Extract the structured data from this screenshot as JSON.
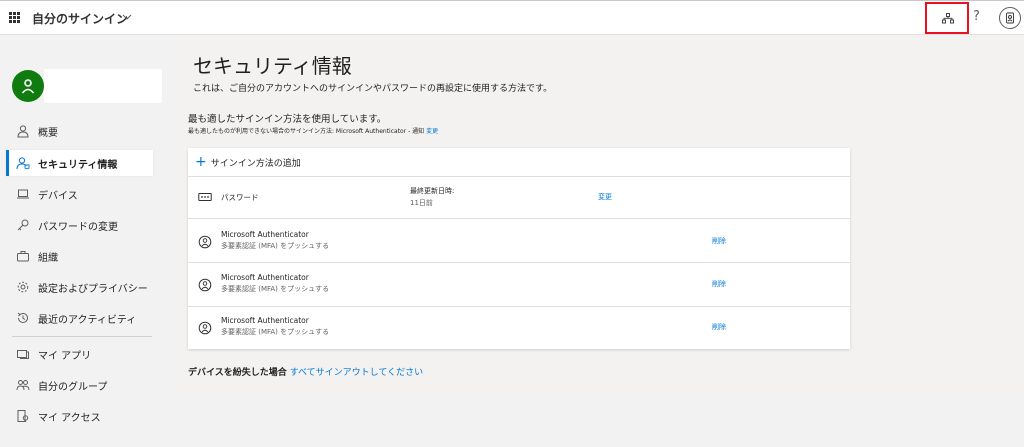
{
  "header": {
    "app_title": "自分のサインイン",
    "help_label": "?"
  },
  "sidebar": {
    "items": [
      {
        "label": "概要"
      },
      {
        "label": "セキュリティ情報"
      },
      {
        "label": "デバイス"
      },
      {
        "label": "パスワードの変更"
      },
      {
        "label": "組織"
      },
      {
        "label": "設定およびプライバシー"
      },
      {
        "label": "最近のアクティビティ"
      },
      {
        "label": "マイ アプリ"
      },
      {
        "label": "自分のグループ"
      },
      {
        "label": "マイ アクセス"
      }
    ]
  },
  "main": {
    "title": "セキュリティ情報",
    "description": "これは、ご自分のアカウントへのサインインやパスワードの再設定に使用する方法です。",
    "default_heading": "最も適したサインイン方法を使用しています。",
    "default_sub_text": "最も適したものが利用できない場合のサインイン方法: Microsoft Authenticator - 通知",
    "default_sub_link": "変更",
    "add_method_label": "サインイン方法の追加",
    "methods": [
      {
        "name": "パスワード",
        "mid_label": "最終更新日時:",
        "mid_value": "11日前",
        "action": "変更"
      },
      {
        "name": "Microsoft Authenticator",
        "sub": "多要素認証 (MFA) をプッシュする",
        "action": "削除"
      },
      {
        "name": "Microsoft Authenticator",
        "sub": "多要素認証 (MFA) をプッシュする",
        "action": "削除"
      },
      {
        "name": "Microsoft Authenticator",
        "sub": "多要素認証 (MFA) をプッシュする",
        "action": "削除"
      }
    ],
    "lost_device_bold": "デバイスを紛失した場合",
    "lost_device_link": "すべてサインアウトしてください"
  },
  "colors": {
    "accent": "#0078d4",
    "avatar_green": "#107c10",
    "highlight_red": "#e81123"
  },
  "icons": {
    "waffle": "waffle-icon",
    "chevron": "chevron-down-icon",
    "org": "organization-icon",
    "help": "help-icon",
    "account": "account-icon",
    "password": "password-icon",
    "authenticator": "authenticator-icon"
  }
}
